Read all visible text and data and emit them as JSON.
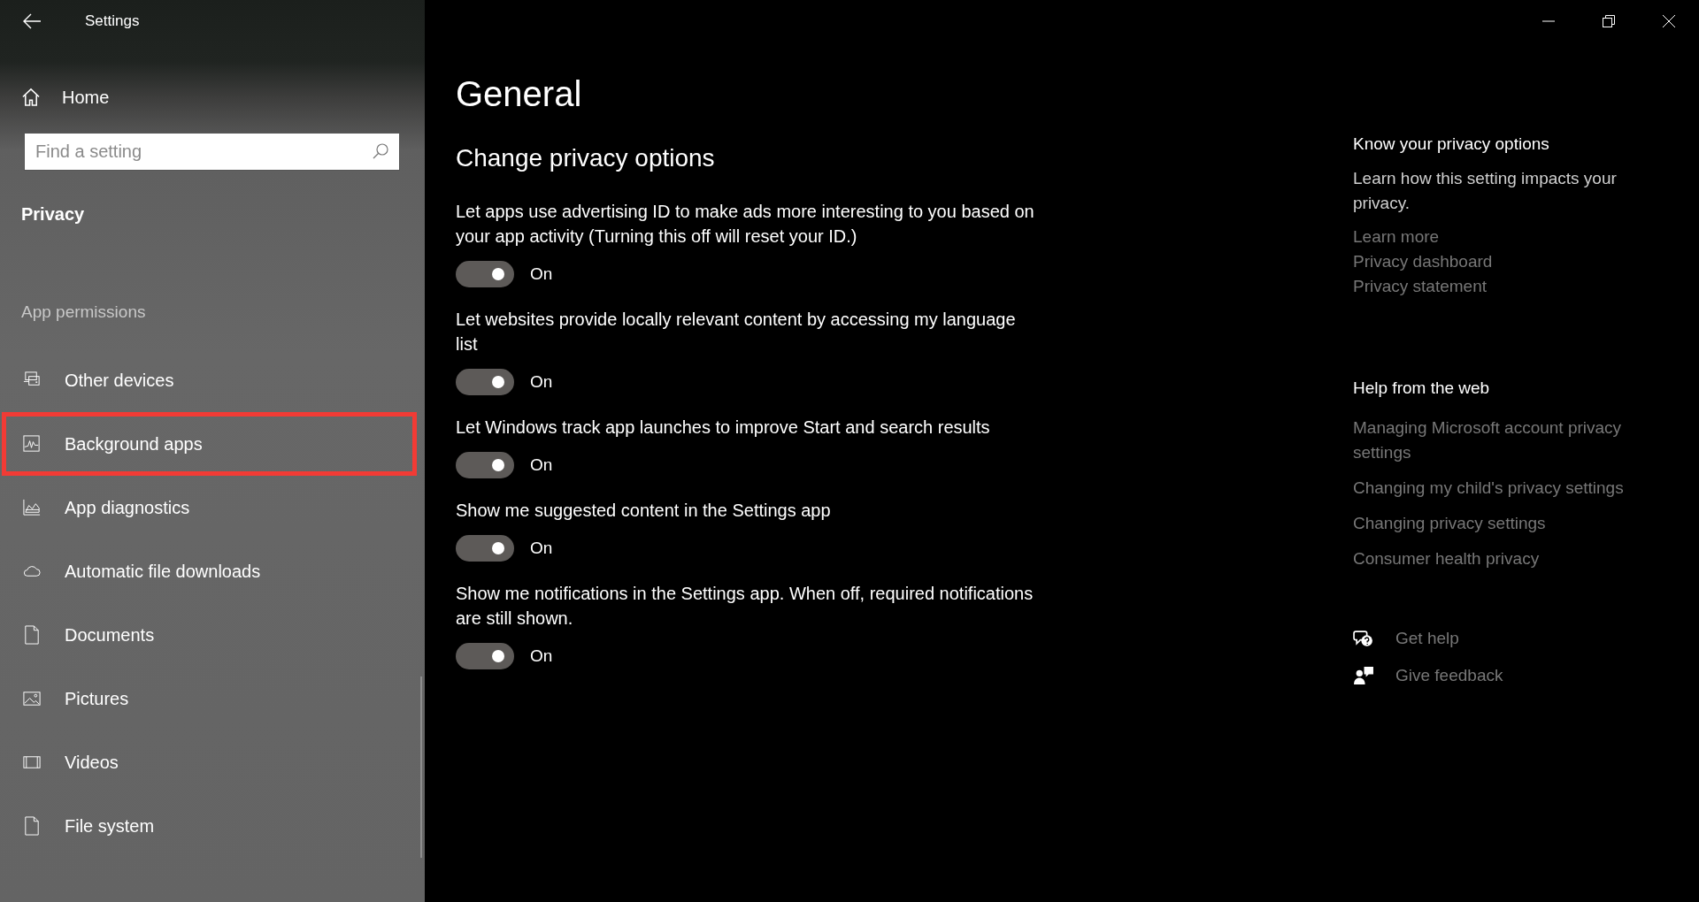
{
  "window": {
    "title": "Settings"
  },
  "sidebar": {
    "home": "Home",
    "search": {
      "placeholder": "Find a setting"
    },
    "section": "Privacy",
    "group": "App permissions",
    "items": [
      {
        "label": "Other devices",
        "selected": false
      },
      {
        "label": "Background apps",
        "selected": true
      },
      {
        "label": "App diagnostics",
        "selected": false
      },
      {
        "label": "Automatic file downloads",
        "selected": false
      },
      {
        "label": "Documents",
        "selected": false
      },
      {
        "label": "Pictures",
        "selected": false
      },
      {
        "label": "Videos",
        "selected": false
      },
      {
        "label": "File system",
        "selected": false
      }
    ]
  },
  "main": {
    "title": "General",
    "subtitle": "Change privacy options",
    "settings": [
      {
        "label": "Let apps use advertising ID to make ads more interesting to you based on your app activity (Turning this off will reset your ID.)",
        "on": true,
        "state": "On"
      },
      {
        "label": "Let websites provide locally relevant content by accessing my language list",
        "on": true,
        "state": "On"
      },
      {
        "label": "Let Windows track app launches to improve Start and search results",
        "on": true,
        "state": "On"
      },
      {
        "label": "Show me suggested content in the Settings app",
        "on": true,
        "state": "On"
      },
      {
        "label": "Show me notifications in the Settings app. When off, required notifications are still shown.",
        "on": true,
        "state": "On"
      }
    ]
  },
  "aside": {
    "privacy_title": "Know your privacy options",
    "privacy_text": "Learn how this setting impacts your privacy.",
    "privacy_links": [
      "Learn more",
      "Privacy dashboard",
      "Privacy statement"
    ],
    "web_title": "Help from the web",
    "web_links": [
      "Managing Microsoft account privacy settings",
      "Changing my child's privacy settings",
      "Changing privacy settings",
      "Consumer health privacy"
    ],
    "actions": [
      "Get help",
      "Give feedback"
    ]
  }
}
